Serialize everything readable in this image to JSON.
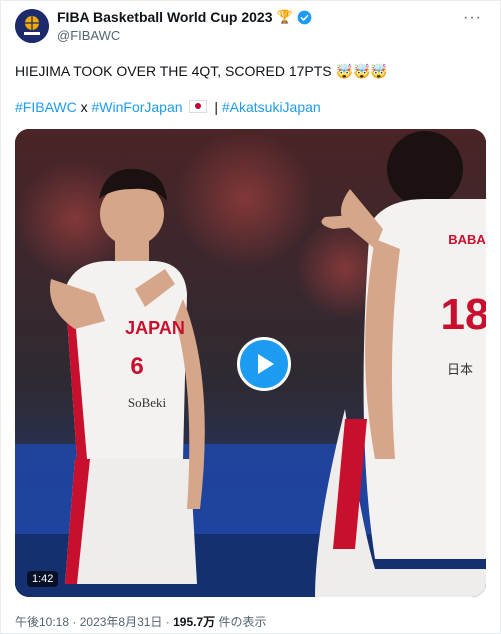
{
  "account": {
    "name": "FIBA Basketball World Cup 2023",
    "handle": "@FIBAWC",
    "trophy": "🏆",
    "more": "···"
  },
  "tweet": {
    "text": "HIEJIMA TOOK OVER THE 4QT, SCORED 17PTS 🤯🤯🤯",
    "hashtag1": "#FIBAWC",
    "x_sep": "x",
    "hashtag2": "#WinForJapan",
    "bar_sep": "|",
    "hashtag3": "#AkatsukiJapan"
  },
  "video": {
    "duration": "1:42",
    "left_jersey_team": "JAPAN",
    "left_jersey_number": "6",
    "left_jersey_sponsor": "SoBeki",
    "right_jersey_name": "BABA",
    "right_jersey_number": "18",
    "right_jersey_sponsor": "日本"
  },
  "footer": {
    "time": "午後10:18",
    "dot": "·",
    "date": "2023年8月31日",
    "views": "195.7万",
    "views_suffix": "件の表示"
  },
  "colors": {
    "accent": "#1d9bf0",
    "jersey_red": "#c8102e"
  }
}
